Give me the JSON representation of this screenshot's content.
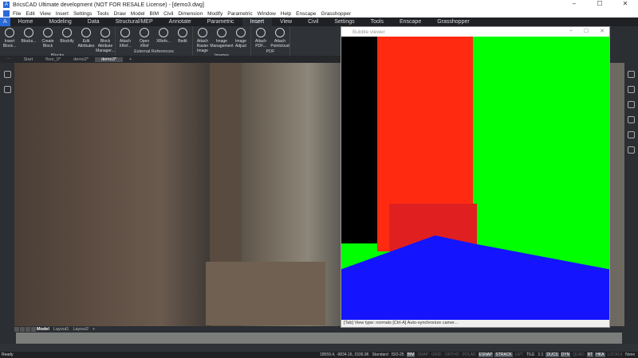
{
  "window": {
    "title": "BricsCAD Ultimate development (NOT FOR RESALE License) - [demo3.dwg]",
    "app_icon": "A",
    "controls": [
      "–",
      "☐",
      "✕"
    ]
  },
  "menu": [
    "File",
    "Edit",
    "View",
    "Insert",
    "Settings",
    "Tools",
    "Draw",
    "Model",
    "BIM",
    "Civil",
    "Dimension",
    "Modify",
    "Parametric",
    "Window",
    "Help",
    "Enscape",
    "Grasshopper"
  ],
  "ribbon_tabs": [
    "Home",
    "Modeling",
    "Data",
    "Structural/MEP",
    "Annotate",
    "Parametric",
    "Insert",
    "View",
    "Civil",
    "Settings",
    "Tools",
    "Enscape",
    "Grasshopper"
  ],
  "active_tab": "Insert",
  "groups": [
    {
      "label": "Blocks",
      "items": [
        "Insert Block...",
        "Blocks...",
        "Create Block",
        "Blockify",
        "Edit Attributes",
        "Block Attribute Manager..."
      ]
    },
    {
      "label": "External References",
      "items": [
        "Attach XRef...",
        "Open XRef",
        "XRefs...",
        "Bedit"
      ]
    },
    {
      "label": "Images",
      "items": [
        "Attach Raster Image",
        "Image Management",
        "Image Adjust"
      ]
    },
    {
      "label": "PDF",
      "items": [
        "Attach PDF...",
        "Attach Pointcloud"
      ]
    }
  ],
  "doc_tabs": [
    "Start",
    "floor_0*",
    "demo2*",
    "demo3*",
    "+"
  ],
  "active_doc": "demo3*",
  "layout_tabs": [
    "Model",
    "Layout1",
    "Layout2",
    "+"
  ],
  "bubble_viewer": {
    "title": "Bubble viewer",
    "status": "[Tab] View type: normals    [Ctrl-A] Auto-synchronize camer..."
  },
  "status": {
    "left": "Ready",
    "coords": "18559.4, -9834.16, 1536.96",
    "items": [
      {
        "t": "Standard",
        "s": "n"
      },
      {
        "t": "ISO-25",
        "s": "n"
      },
      {
        "t": "BIM",
        "s": "on"
      },
      {
        "t": "SNAP",
        "s": "off"
      },
      {
        "t": "GRID",
        "s": "off"
      },
      {
        "t": "ORTHO",
        "s": "off"
      },
      {
        "t": "POLAR",
        "s": "off"
      },
      {
        "t": "ESNAP",
        "s": "on"
      },
      {
        "t": "STRACK",
        "s": "on"
      },
      {
        "t": "LWT",
        "s": "off"
      },
      {
        "t": "TILE",
        "s": "n"
      },
      {
        "t": "1:1",
        "s": "n"
      },
      {
        "t": "DUCS",
        "s": "on"
      },
      {
        "t": "DYN",
        "s": "on"
      },
      {
        "t": "QUAD",
        "s": "off"
      },
      {
        "t": "RT",
        "s": "on"
      },
      {
        "t": "HKA",
        "s": "on"
      },
      {
        "t": "LOCKUI",
        "s": "off"
      },
      {
        "t": "None",
        "s": "n"
      }
    ]
  }
}
